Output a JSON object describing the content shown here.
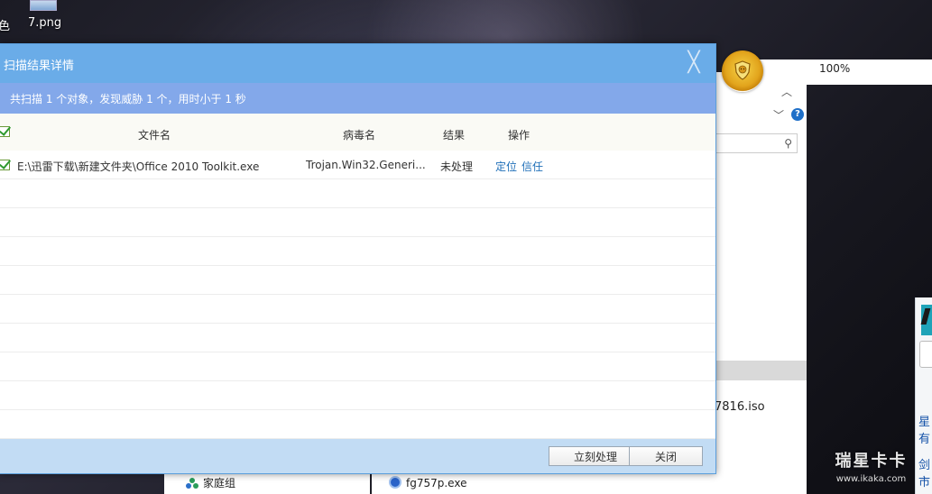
{
  "desktop": {
    "icon_label_left": "色",
    "icon_label": "7.png"
  },
  "background_window": {
    "iso_name": "7816.iso",
    "homegroup": "家庭组",
    "exe_name": "fg757p.exe"
  },
  "progress": {
    "value_percent": 100,
    "label": "100%"
  },
  "right_edge": {
    "text1": "星有",
    "text2": "剑市"
  },
  "watermark": {
    "line1": "瑞星卡卡",
    "line2": "www.ikaka.com"
  },
  "dialog": {
    "title": "扫描结果详情",
    "close_glyph": "╳",
    "summary": "共扫描 1 个对象，发现威胁 1 个，用时小于 1 秒",
    "columns": {
      "file": "文件名",
      "virus": "病毒名",
      "result": "结果",
      "action": "操作"
    },
    "rows": [
      {
        "file": "E:\\迅雷下载\\新建文件夹\\Office 2010 Toolkit.exe",
        "virus": "Trojan.Win32.Generi...",
        "result": "未处理",
        "locate": "定位",
        "trust": "信任"
      }
    ],
    "buttons": {
      "process": "立刻处理",
      "close": "关闭"
    }
  },
  "colors": {
    "title_bar": "#6aace8",
    "summary_bar": "#83a8ea",
    "footer": "#c2dcf4",
    "link": "#1f6fb8",
    "progress_green": "#56b418"
  }
}
